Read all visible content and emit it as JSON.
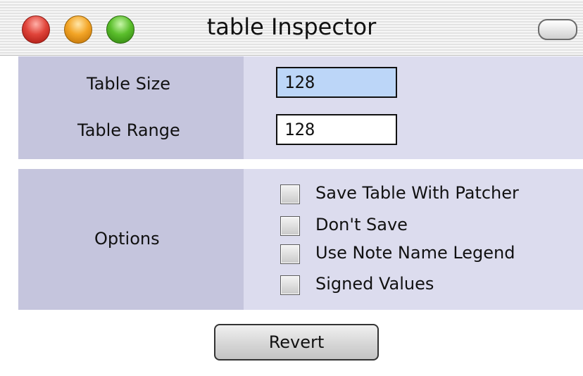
{
  "window": {
    "title": "table Inspector"
  },
  "size_section": {
    "table_size_label": "Table Size",
    "table_size_value": "128",
    "table_range_label": "Table Range",
    "table_range_value": "128"
  },
  "options_section": {
    "label": "Options",
    "checkboxes": [
      {
        "label": "Save Table With Patcher",
        "checked": false
      },
      {
        "label": "Don't Save",
        "checked": false
      },
      {
        "label": "Use Note Name Legend",
        "checked": false
      },
      {
        "label": "Signed Values",
        "checked": false
      }
    ]
  },
  "buttons": {
    "revert_label": "Revert"
  },
  "colors": {
    "section_background": "#dcdcee",
    "label_column_background": "#c5c5dd",
    "active_field": "#bcd6f8"
  }
}
